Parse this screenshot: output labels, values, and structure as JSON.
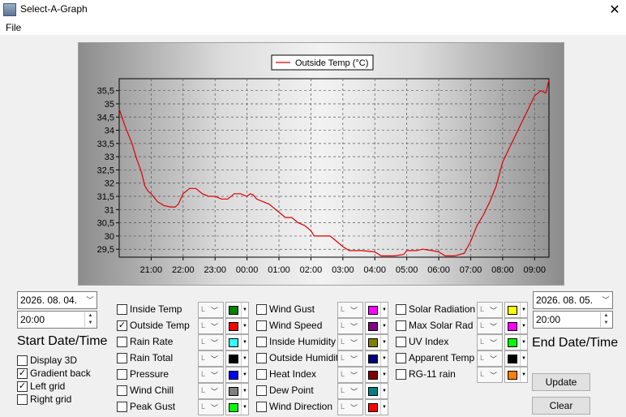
{
  "window": {
    "title": "Select-A-Graph"
  },
  "menu": {
    "file": "File"
  },
  "chart_data": {
    "type": "line",
    "series": [
      {
        "name": "Outside Temp (°C)",
        "color": "#dc0000",
        "points": [
          [
            0,
            34.8
          ],
          [
            0.2,
            34.1
          ],
          [
            0.4,
            33.5
          ],
          [
            0.55,
            32.9
          ],
          [
            0.7,
            32.4
          ],
          [
            0.8,
            31.9
          ],
          [
            0.9,
            31.7
          ],
          [
            1.0,
            31.6
          ],
          [
            1.2,
            31.3
          ],
          [
            1.4,
            31.15
          ],
          [
            1.6,
            31.1
          ],
          [
            1.75,
            31.1
          ],
          [
            1.85,
            31.2
          ],
          [
            2.0,
            31.6
          ],
          [
            2.2,
            31.8
          ],
          [
            2.4,
            31.8
          ],
          [
            2.6,
            31.6
          ],
          [
            2.8,
            31.5
          ],
          [
            3.0,
            31.5
          ],
          [
            3.2,
            31.4
          ],
          [
            3.4,
            31.4
          ],
          [
            3.6,
            31.6
          ],
          [
            3.8,
            31.6
          ],
          [
            4.0,
            31.5
          ],
          [
            4.1,
            31.6
          ],
          [
            4.2,
            31.55
          ],
          [
            4.3,
            31.4
          ],
          [
            4.5,
            31.3
          ],
          [
            4.7,
            31.2
          ],
          [
            4.8,
            31.1
          ],
          [
            5.0,
            30.9
          ],
          [
            5.2,
            30.7
          ],
          [
            5.4,
            30.7
          ],
          [
            5.6,
            30.5
          ],
          [
            5.8,
            30.4
          ],
          [
            6.0,
            30.2
          ],
          [
            6.1,
            30.0
          ],
          [
            6.3,
            30.0
          ],
          [
            6.6,
            30.0
          ],
          [
            6.8,
            29.8
          ],
          [
            7.0,
            29.6
          ],
          [
            7.2,
            29.45
          ],
          [
            7.6,
            29.45
          ],
          [
            8.0,
            29.4
          ],
          [
            8.2,
            29.25
          ],
          [
            8.6,
            29.25
          ],
          [
            8.9,
            29.3
          ],
          [
            9.0,
            29.45
          ],
          [
            9.3,
            29.45
          ],
          [
            9.5,
            29.5
          ],
          [
            9.8,
            29.45
          ],
          [
            10.0,
            29.4
          ],
          [
            10.2,
            29.25
          ],
          [
            10.5,
            29.25
          ],
          [
            10.8,
            29.35
          ],
          [
            11.0,
            29.8
          ],
          [
            11.2,
            30.4
          ],
          [
            11.4,
            30.8
          ],
          [
            11.6,
            31.3
          ],
          [
            11.8,
            31.9
          ],
          [
            12.0,
            32.8
          ],
          [
            12.2,
            33.3
          ],
          [
            12.4,
            33.8
          ],
          [
            12.6,
            34.3
          ],
          [
            12.8,
            34.8
          ],
          [
            13.0,
            35.3
          ],
          [
            13.2,
            35.5
          ],
          [
            13.35,
            35.4
          ],
          [
            13.45,
            35.9
          ]
        ]
      }
    ],
    "xticks": [
      "21:00",
      "22:00",
      "23:00",
      "00:00",
      "01:00",
      "02:00",
      "03:00",
      "04:00",
      "05:00",
      "06:00",
      "07:00",
      "08:00",
      "09:00"
    ],
    "xtick_positions": [
      1,
      2,
      3,
      4,
      5,
      6,
      7,
      8,
      9,
      10,
      11,
      12,
      13
    ],
    "xlim": [
      0,
      13.45
    ],
    "yticks": [
      29.5,
      30,
      30.5,
      31,
      31.5,
      32,
      32.5,
      33,
      33.5,
      34,
      34.5,
      35,
      35.5
    ],
    "ylim": [
      29.2,
      35.95
    ],
    "grid": true,
    "legend": "top-center"
  },
  "start": {
    "date": "2026. 08. 04.",
    "time": "20:00",
    "label": "Start Date/Time"
  },
  "end": {
    "date": "2026. 08. 05.",
    "time": "20:00",
    "label": "End Date/Time"
  },
  "options": [
    {
      "label": "Display 3D",
      "checked": false
    },
    {
      "label": "Gradient back",
      "checked": true
    },
    {
      "label": "Left grid",
      "checked": true
    },
    {
      "label": "Right grid",
      "checked": false
    }
  ],
  "series_cols": [
    [
      {
        "label": "Inside Temp",
        "checked": false,
        "axis": "L",
        "color": "#008000"
      },
      {
        "label": "Outside Temp",
        "checked": true,
        "axis": "L",
        "color": "#ff0000"
      },
      {
        "label": "Rain Rate",
        "checked": false,
        "axis": "L",
        "color": "#33ffff"
      },
      {
        "label": "Rain Total",
        "checked": false,
        "axis": "L",
        "color": "#000000"
      },
      {
        "label": "Pressure",
        "checked": false,
        "axis": "L",
        "color": "#0000ff"
      },
      {
        "label": "Wind Chill",
        "checked": false,
        "axis": "L",
        "color": "#808080"
      },
      {
        "label": "Peak Gust",
        "checked": false,
        "axis": "L",
        "color": "#00ff00"
      }
    ],
    [
      {
        "label": "Wind Gust",
        "checked": false,
        "axis": "L",
        "color": "#ff00ff"
      },
      {
        "label": "Wind Speed",
        "checked": false,
        "axis": "L",
        "color": "#800080"
      },
      {
        "label": "Inside Humidity",
        "checked": false,
        "axis": "L",
        "color": "#808000"
      },
      {
        "label": "Outside Humidity",
        "checked": false,
        "axis": "L",
        "color": "#000080"
      },
      {
        "label": "Heat Index",
        "checked": false,
        "axis": "L",
        "color": "#800000"
      },
      {
        "label": "Dew Point",
        "checked": false,
        "axis": "L",
        "color": "#008080"
      },
      {
        "label": "Wind Direction",
        "checked": false,
        "axis": "L",
        "color": "#ff0000"
      }
    ],
    [
      {
        "label": "Solar Radiation",
        "checked": false,
        "axis": "L",
        "color": "#ffff00"
      },
      {
        "label": "Max Solar Rad",
        "checked": false,
        "axis": "L",
        "color": "#ff00ff"
      },
      {
        "label": "UV Index",
        "checked": false,
        "axis": "L",
        "color": "#00ff00"
      },
      {
        "label": "Apparent Temp",
        "checked": false,
        "axis": "L",
        "color": "#000000"
      },
      {
        "label": "RG-11 rain",
        "checked": false,
        "axis": "L",
        "color": "#ff8000"
      }
    ]
  ],
  "buttons": {
    "update": "Update",
    "clear": "Clear"
  }
}
